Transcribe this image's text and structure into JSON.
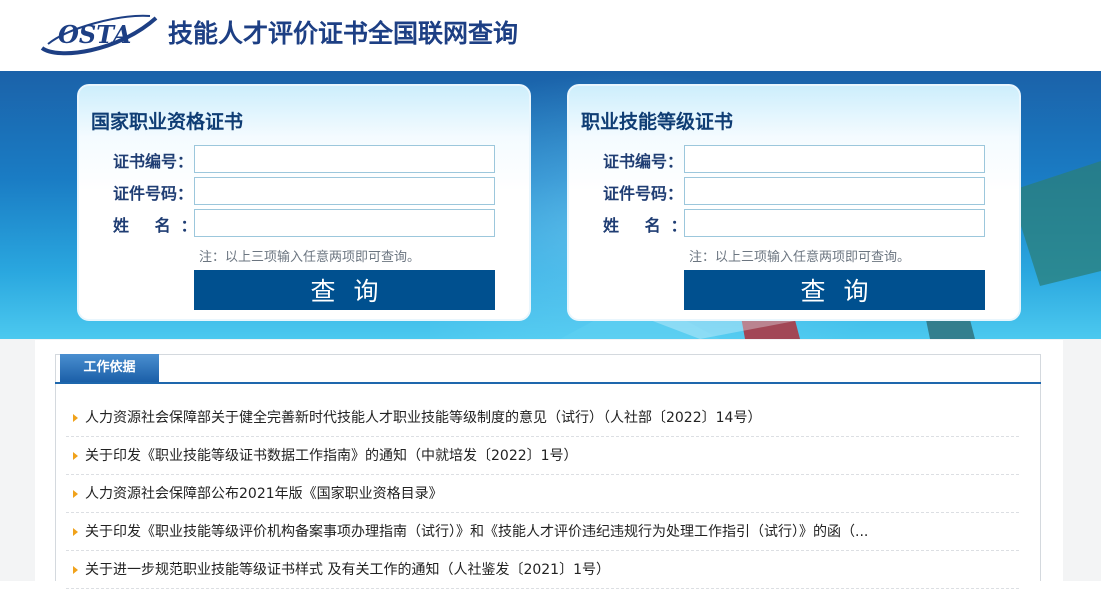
{
  "header": {
    "logo_text": "OSTA",
    "title": "技能人才评价证书全国联网查询"
  },
  "cards": [
    {
      "title": "国家职业资格证书",
      "fields": [
        {
          "label": "证书编号：",
          "value": ""
        },
        {
          "label": "证件号码：",
          "value": ""
        },
        {
          "label": "姓 名：",
          "value": ""
        }
      ],
      "note": "注：以上三项输入任意两项即可查询。",
      "button": "查询"
    },
    {
      "title": "职业技能等级证书",
      "fields": [
        {
          "label": "证书编号：",
          "value": ""
        },
        {
          "label": "证件号码：",
          "value": ""
        },
        {
          "label": "姓 名：",
          "value": ""
        }
      ],
      "note": "注：以上三项输入任意两项即可查询。",
      "button": "查询"
    }
  ],
  "panel": {
    "tab": "工作依据",
    "items": [
      "人力资源社会保障部关于健全完善新时代技能人才职业技能等级制度的意见（试行）（人社部〔2022〕14号）",
      "关于印发《职业技能等级证书数据工作指南》的通知（中就培发〔2022〕1号）",
      "人力资源社会保障部公布2021年版《国家职业资格目录》",
      "关于印发《职业技能等级评价机构备案事项办理指南（试行）》和《技能人才评价违纪违规行为处理工作指引（试行）》的函（...",
      "关于进一步规范职业技能等级证书样式 及有关工作的通知（人社鉴发〔2021〕1号）"
    ]
  },
  "colors": {
    "title": "#1d3f84",
    "button": "#00508f",
    "tab": "#1b5fa8",
    "bullet": "#f0a21b"
  }
}
